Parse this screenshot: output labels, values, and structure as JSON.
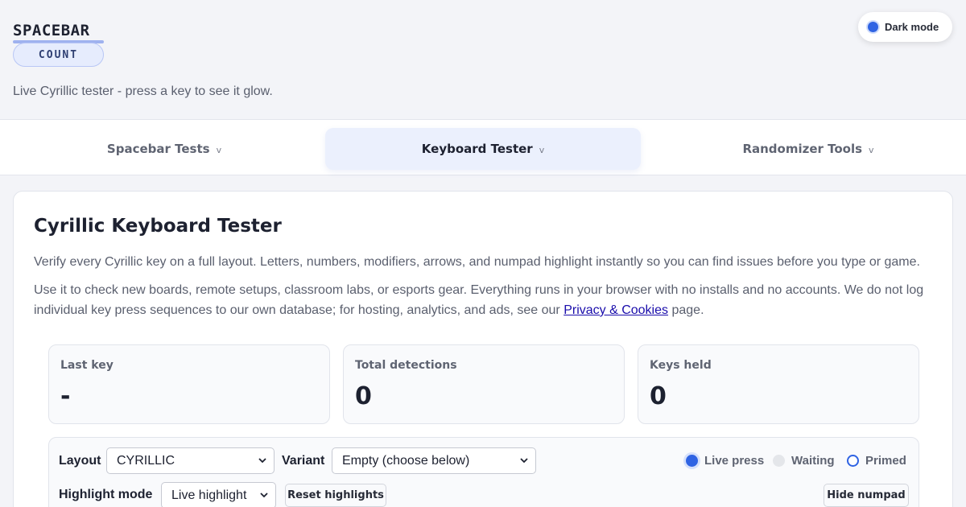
{
  "brand": {
    "word": "SPACEBAR",
    "sub": "COUNT"
  },
  "tagline": "Live Cyrillic tester - press a key to see it glow.",
  "dark_mode": {
    "label": "Dark mode"
  },
  "nav": [
    {
      "label": "Spacebar Tests",
      "chevron": "v",
      "active": false
    },
    {
      "label": "Keyboard Tester",
      "chevron": "v",
      "active": true
    },
    {
      "label": "Randomizer Tools",
      "chevron": "v",
      "active": false
    }
  ],
  "card": {
    "title": "Cyrillic Keyboard Tester",
    "desc1": "Verify every Cyrillic key on a full layout. Letters, numbers, modifiers, arrows, and numpad highlight instantly so you can find issues before you type or game.",
    "desc2_pre": "Use it to check new boards, remote setups, classroom labs, or esports gear. Everything runs in your browser with no installs and no accounts. We do not log individual key press sequences to our own database; for hosting, analytics, and ads, see our",
    "desc2_link": "Privacy & Cookies",
    "desc2_post": "page."
  },
  "stats": [
    {
      "label": "Last key",
      "value": "-"
    },
    {
      "label": "Total detections",
      "value": "0"
    },
    {
      "label": "Keys held",
      "value": "0"
    }
  ],
  "controls": {
    "layout_label": "Layout",
    "layout_value": "CYRILLIC",
    "variant_label": "Variant",
    "variant_value": "Empty (choose below)",
    "highlight_label": "Highlight mode",
    "highlight_value": "Live highlight",
    "reset_label": "Reset highlights",
    "hide_numpad_label": "Hide numpad",
    "legend": {
      "live": "Live press",
      "waiting": "Waiting",
      "primed": "Primed"
    }
  },
  "colors": {
    "accent": "#2f63e3",
    "link": "#1a0dab",
    "active_tab_bg": "#ebf0fd"
  }
}
